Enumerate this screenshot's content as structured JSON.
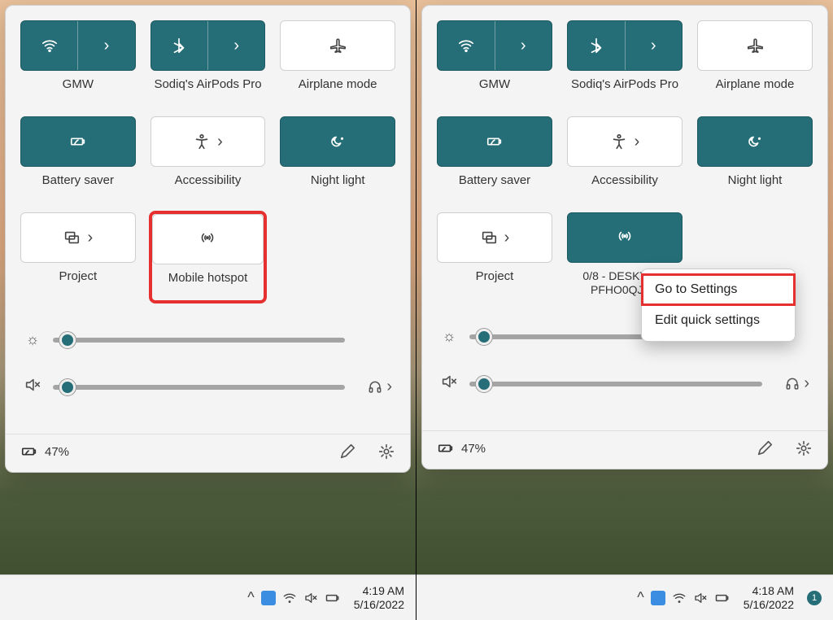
{
  "colors": {
    "accent": "#256d77",
    "highlight": "#e63030"
  },
  "left": {
    "tiles": {
      "wifi": {
        "label": "GMW",
        "on": true
      },
      "bluetooth": {
        "label": "Sodiq's AirPods Pro",
        "on": true
      },
      "airplane": {
        "label": "Airplane mode",
        "on": false
      },
      "battery": {
        "label": "Battery saver",
        "on": true
      },
      "access": {
        "label": "Accessibility",
        "on": false
      },
      "nightlight": {
        "label": "Night light",
        "on": true
      },
      "project": {
        "label": "Project",
        "on": false
      },
      "hotspot": {
        "label": "Mobile hotspot",
        "on": false,
        "highlight": true
      }
    },
    "brightness_pct": 5,
    "volume_pct": 5,
    "volume_muted": true,
    "battery_pct": "47%",
    "taskbar": {
      "time": "4:19 AM",
      "date": "5/16/2022"
    }
  },
  "right": {
    "tiles": {
      "wifi": {
        "label": "GMW",
        "on": true
      },
      "bluetooth": {
        "label": "Sodiq's AirPods Pro",
        "on": true
      },
      "airplane": {
        "label": "Airplane mode",
        "on": false
      },
      "battery": {
        "label": "Battery saver",
        "on": true
      },
      "access": {
        "label": "Accessibility",
        "on": false
      },
      "nightlight": {
        "label": "Night light",
        "on": true
      },
      "project": {
        "label": "Project",
        "on": false
      },
      "hotspot": {
        "label": "0/8 - DESKTOP-PFHO0QJ 98",
        "on": true
      }
    },
    "context_menu": {
      "items": {
        "go_settings": "Go to Settings",
        "edit_quick": "Edit quick settings"
      },
      "highlight_first": true
    },
    "brightness_pct": 5,
    "volume_pct": 5,
    "volume_muted": true,
    "battery_pct": "47%",
    "taskbar": {
      "time": "4:18 AM",
      "date": "5/16/2022",
      "notification_count": "1"
    }
  }
}
